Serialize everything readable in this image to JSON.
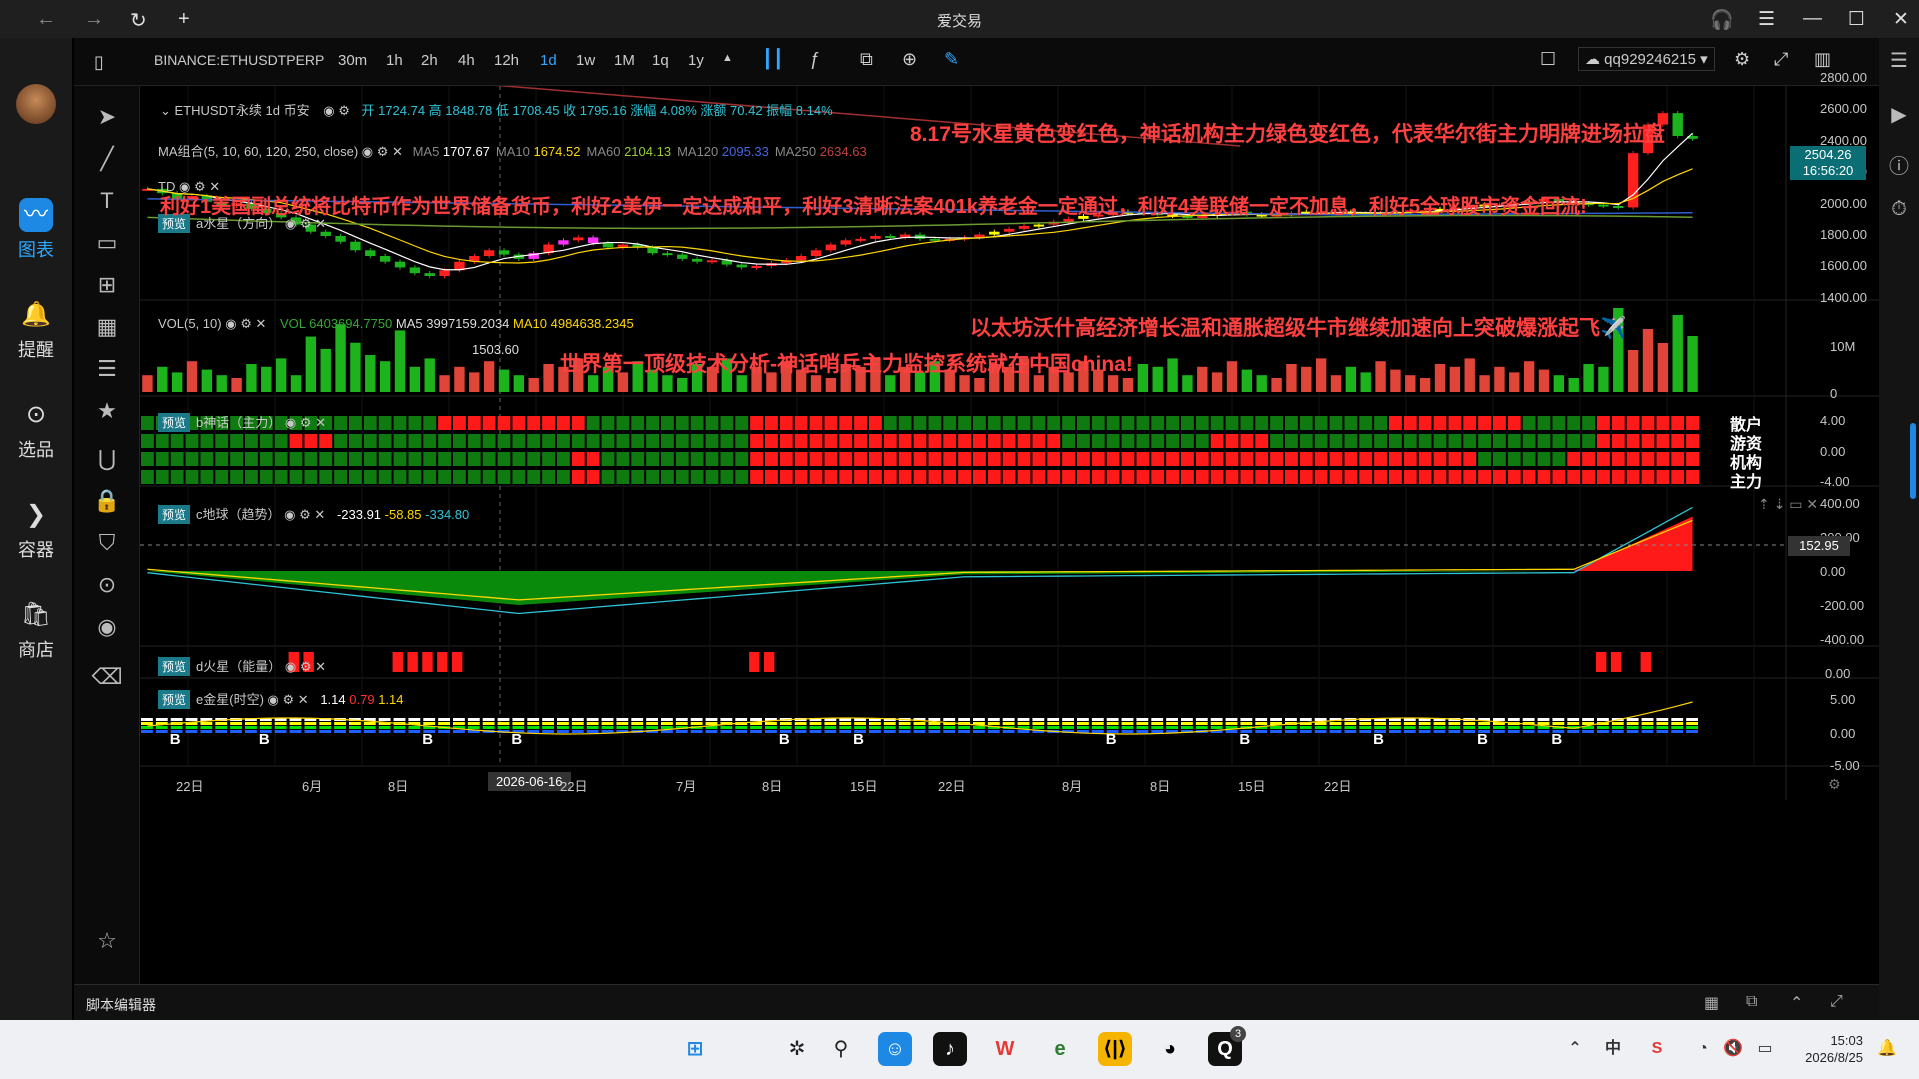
{
  "window": {
    "title": "爱交易",
    "back": "←",
    "forward": "→",
    "reload": "↻",
    "new_tab": "+",
    "headset": "🎧",
    "menu": "☰",
    "minimize": "—",
    "maximize": "☐",
    "close": "✕"
  },
  "sidebar": {
    "items": [
      {
        "label": "图表",
        "icon": "chart-icon"
      },
      {
        "label": "提醒",
        "icon": "bell-icon"
      },
      {
        "label": "选品",
        "icon": "search-icon"
      },
      {
        "label": "容器",
        "icon": "container-icon"
      },
      {
        "label": "商店",
        "icon": "store-icon"
      }
    ]
  },
  "toolbar": {
    "symbol": "BINANCE:ETHUSDTPERP",
    "intervals": [
      "30m",
      "1h",
      "2h",
      "4h",
      "12h",
      "1d",
      "1w",
      "1M",
      "1q",
      "1y"
    ],
    "active_interval": "1d",
    "user": "qq929246215"
  },
  "legend": {
    "main": {
      "name": "ETHUSDT永续 1d 币安",
      "stats": "开 1724.74 高 1848.78 低 1708.45 收 1795.16 涨幅 4.08% 涨额 70.42 振幅 8.14%"
    },
    "ma": {
      "name": "MA组合(5, 10, 60, 120, 250, close)",
      "items": [
        {
          "k": "MA5",
          "v": "1707.67",
          "c": "#ffffff"
        },
        {
          "k": "MA10",
          "v": "1674.52",
          "c": "#ffd700"
        },
        {
          "k": "MA60",
          "v": "2104.13",
          "c": "#9acd32"
        },
        {
          "k": "MA120",
          "v": "2095.33",
          "c": "#4169e1"
        },
        {
          "k": "MA250",
          "v": "2634.63",
          "c": "#c04040"
        }
      ]
    },
    "td": "TD",
    "a": {
      "tag": "预览",
      "name": "a水星（方向）"
    }
  },
  "annotations": {
    "line1": "8.17号水星黄色变红色，神话机构主力绿色变红色，代表华尔街主力明牌进场拉盘",
    "line2": "利好1美国副总统将比特币作为世界储备货币，利好2美伊一定达成和平，利好3清晰法案401k养老金一定通过，利好4美联储一定不加息，利好5全球股市资金回流!",
    "line3": "以太坊沃什高经济增长温和通胀超级牛市继续加速向上突破爆涨起飞✈️",
    "line4": "世界第一顶级技术分析-神话哨兵主力监控系统就在中国china!",
    "low_label": "1503.60"
  },
  "price_axis": {
    "labels": [
      "2800.00",
      "2600.00",
      "2400.00",
      "2200.00",
      "2000.00",
      "1800.00",
      "1600.00",
      "1400.00"
    ],
    "current_price": "2504.26",
    "countdown": "16:56:20"
  },
  "vol": {
    "name": "VOL(5, 10)",
    "vol": "VOL 6403694.7750",
    "ma5": "MA5 3997159.2034",
    "ma10": "MA10 4984638.2345",
    "axis": [
      "10M",
      "0"
    ]
  },
  "b": {
    "tag": "预览",
    "name": "b神话（主力）",
    "rows": [
      "散户",
      "游资",
      "机构",
      "主力"
    ],
    "axis": [
      "4.00",
      "0.00",
      "-4.00"
    ]
  },
  "c": {
    "tag": "预览",
    "name": "c地球（趋势）",
    "v1": "-233.91",
    "v2": "-58.85",
    "v3": "-334.80",
    "axis": [
      "400.00",
      "200.00",
      "0.00",
      "-200.00",
      "-400.00"
    ],
    "badge": "152.95"
  },
  "d": {
    "tag": "预览",
    "name": "d火星（能量）",
    "axis": [
      "0.00"
    ]
  },
  "e": {
    "tag": "预览",
    "name": "e金星(时空)",
    "v1": "1.14",
    "v2": "0.79",
    "v3": "1.14",
    "axis": [
      "5.00",
      "0.00",
      "-5.00"
    ]
  },
  "time_axis": {
    "labels": [
      "22日",
      "6月",
      "8日",
      "2026-06-16",
      "22日",
      "7月",
      "8日",
      "15日",
      "22日",
      "8月",
      "8日",
      "15日",
      "22日"
    ]
  },
  "status": {
    "script_editor": "脚本编辑器"
  },
  "taskbar": {
    "time": "15:03",
    "date": "2026/8/25",
    "qq_badge": "3"
  },
  "chart_data": {
    "type": "candlestick",
    "series": [
      {
        "name": "ETHUSDT",
        "values": [
          2150,
          2120,
          2080,
          2100,
          2060,
          2030,
          2050,
          2010,
          1980,
          1950,
          1900,
          1850,
          1820,
          1780,
          1720,
          1680,
          1640,
          1600,
          1560,
          1540,
          1580,
          1640,
          1680,
          1720,
          1690,
          1660,
          1700,
          1760,
          1790,
          1810,
          1770,
          1740,
          1760,
          1740,
          1700,
          1690,
          1660,
          1640,
          1650,
          1620,
          1600,
          1610,
          1630,
          1650,
          1680,
          1720,
          1760,
          1790,
          1800,
          1820,
          1810,
          1830,
          1800,
          1790,
          1800,
          1810,
          1830,
          1850,
          1870,
          1890,
          1900,
          1920,
          1940,
          1960,
          1970,
          1980,
          1990,
          1980,
          1970,
          1960,
          1950,
          1960,
          1980,
          1990,
          1970,
          1960,
          1970,
          1980,
          1990,
          1990,
          1990,
          1980,
          1970,
          1980,
          1990,
          2000,
          2000,
          2010,
          2020,
          2030,
          2040,
          2040,
          2050,
          2060,
          2080,
          2060,
          2050,
          2040,
          2030,
          2020,
          2400,
          2600,
          2680,
          2520,
          2500
        ]
      }
    ],
    "ylim": [
      1400,
      2800
    ]
  }
}
